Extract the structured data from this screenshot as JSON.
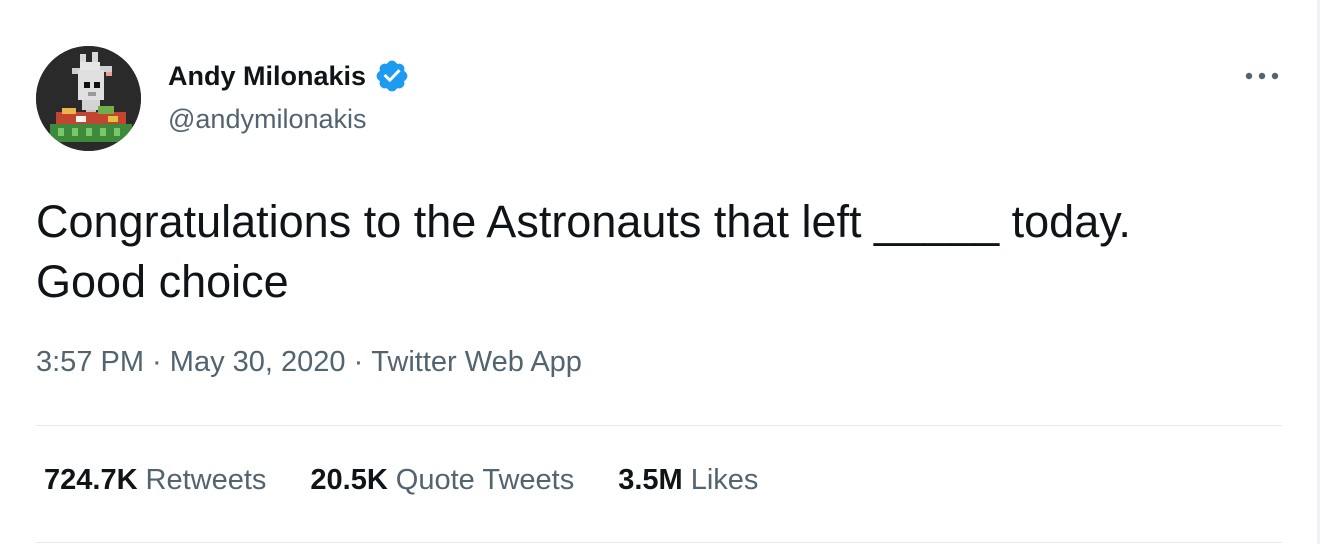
{
  "author": {
    "display_name": "Andy Milonakis",
    "handle": "@andymilonakis",
    "verified": true,
    "avatar_icon": "pixel-goat-avatar-icon",
    "verified_icon": "verified-badge-icon"
  },
  "menu": {
    "icon": "more-options-icon"
  },
  "tweet": {
    "text": "Congratulations to the Astronauts that left _____ today. Good choice"
  },
  "meta": {
    "time": "3:57 PM",
    "separator": " · ",
    "date": "May 30, 2020",
    "source": "Twitter Web App"
  },
  "stats": {
    "retweets": {
      "value": "724.7K",
      "label": "Retweets"
    },
    "quote_tweets": {
      "value": "20.5K",
      "label": "Quote Tweets"
    },
    "likes": {
      "value": "3.5M",
      "label": "Likes"
    }
  },
  "colors": {
    "text_primary": "#0f1419",
    "text_secondary": "#536471",
    "verified_blue": "#1d9bf0",
    "divider": "#e4e9ec"
  }
}
